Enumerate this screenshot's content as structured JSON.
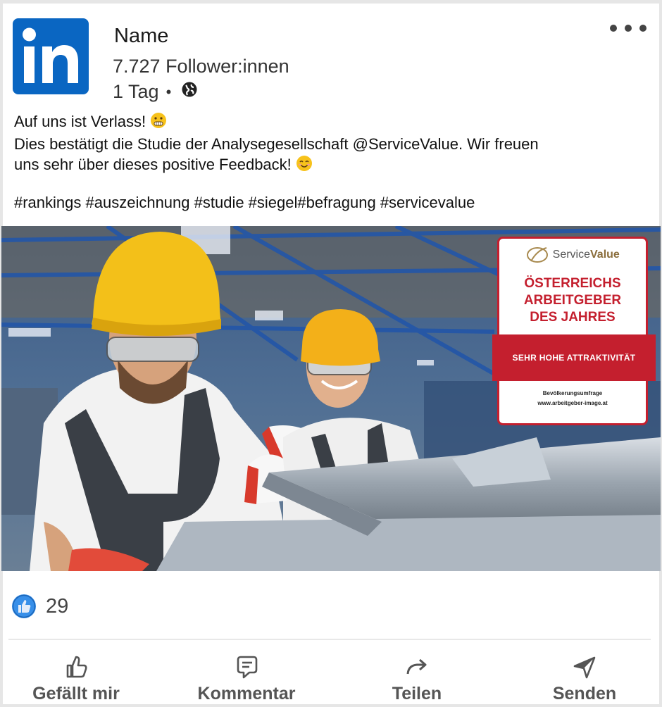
{
  "post": {
    "author": "Name",
    "followers": "7.727 Follower:innen",
    "time": "1 Tag",
    "separator": "•",
    "text_line1": "Auf uns ist Verlass!",
    "text_line2": "Dies bestätigt die Studie der Analysegesellschaft @ServiceValue. Wir freuen",
    "text_line3": "uns sehr über dieses positive Feedback!",
    "hashtags": "#rankings #auszeichnung #studie #siegel#befragung #servicevalue"
  },
  "badge": {
    "brand_prefix": "Service",
    "brand_suffix": "Value",
    "title_line1": "ÖSTERREICHS",
    "title_line2": "ARBEITGEBER",
    "title_line3": "DES JAHRES",
    "band": "SEHR HOHE ATTRAKTIVITÄT",
    "foot_line1": "Bevölkerungsumfrage",
    "foot_line2": "www.arbeitgeber-image.at"
  },
  "reactions": {
    "likes": "29"
  },
  "actions": {
    "like": "Gefällt mir",
    "comment": "Kommentar",
    "share": "Teilen",
    "send": "Senden"
  },
  "icons": {
    "logo": "linkedin-logo",
    "globe": "globe-icon",
    "more": "more-options-icon",
    "like": "thumbs-up-icon",
    "comment": "comment-icon",
    "share": "share-arrow-icon",
    "send": "send-icon"
  },
  "colors": {
    "brand": "#0a66c2",
    "badge_red": "#c41f2e",
    "text": "#191919",
    "muted": "#555555"
  }
}
